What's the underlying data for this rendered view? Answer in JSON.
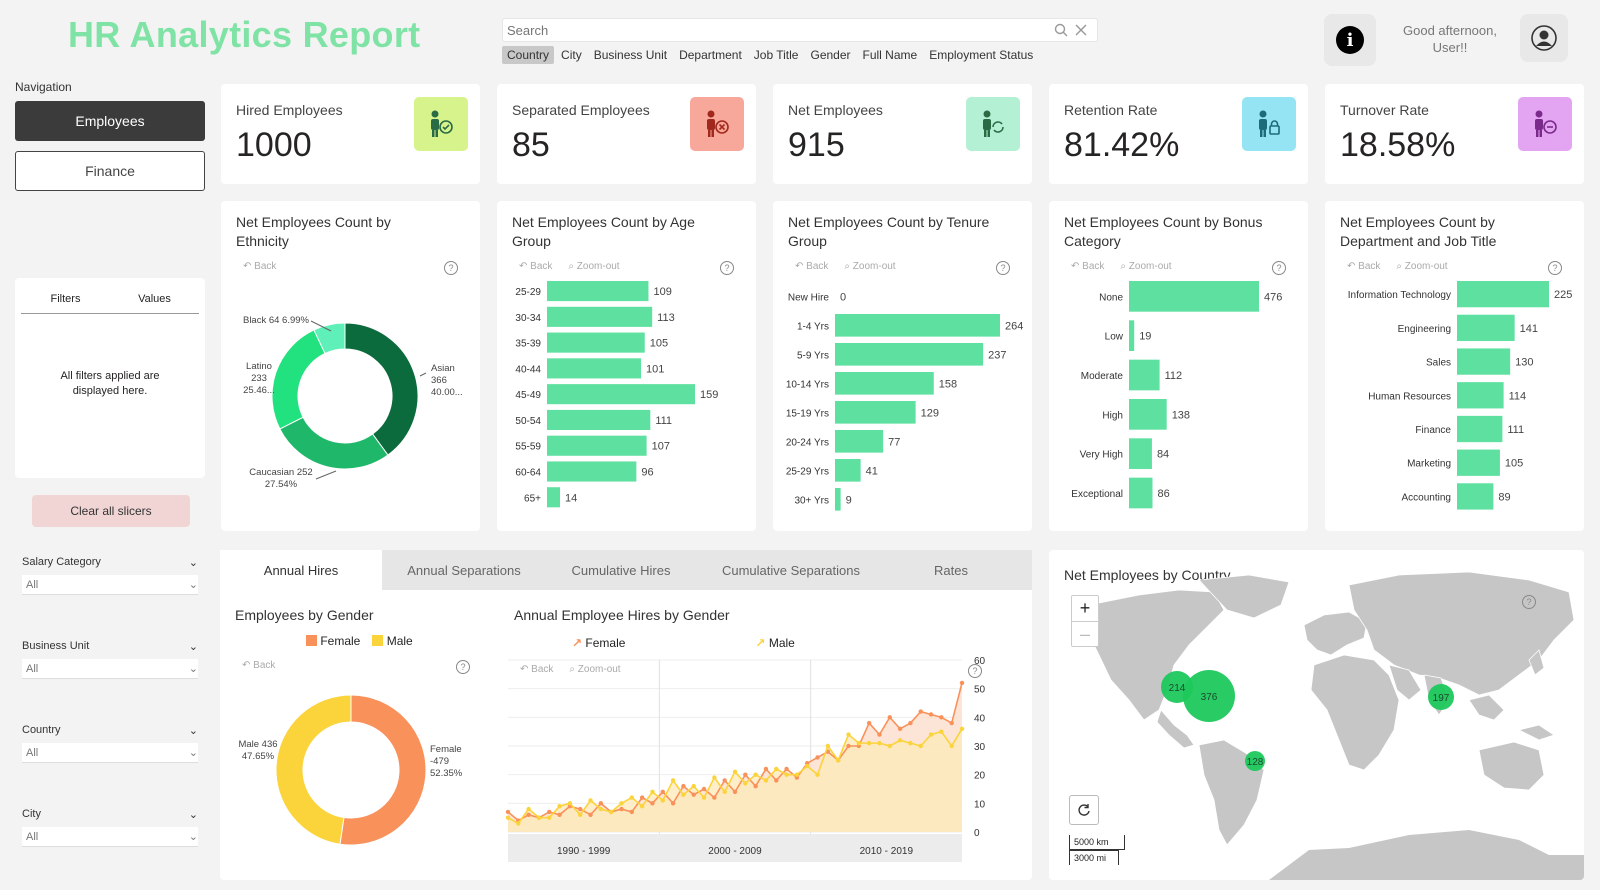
{
  "header": {
    "title": "HR Analytics Report",
    "search_placeholder": "Search",
    "search_fields": [
      "Country",
      "City",
      "Business Unit",
      "Department",
      "Job Title",
      "Gender",
      "Full Name",
      "Employment Status"
    ],
    "greeting": "Good afternoon, User!!"
  },
  "nav": {
    "label": "Navigation",
    "items": [
      "Employees",
      "Finance"
    ],
    "active": "Employees"
  },
  "filters": {
    "col1": "Filters",
    "col2": "Values",
    "message": "All filters applied are displayed here.",
    "clear_label": "Clear all slicers"
  },
  "slicers": [
    {
      "title": "Salary Category",
      "value": "All"
    },
    {
      "title": "Business Unit",
      "value": "All"
    },
    {
      "title": "Country",
      "value": "All"
    },
    {
      "title": "City",
      "value": "All"
    }
  ],
  "kpis": [
    {
      "label": "Hired Employees",
      "value": "1000",
      "icon": "hire-icon",
      "color": "#d7f38c"
    },
    {
      "label": "Separated Employees",
      "value": "85",
      "icon": "separate-icon",
      "color": "#f7a89a"
    },
    {
      "label": "Net Employees",
      "value": "915",
      "icon": "net-icon",
      "color": "#b4f1d4"
    },
    {
      "label": "Retention Rate",
      "value": "81.42%",
      "icon": "retention-icon",
      "color": "#94e4f4"
    },
    {
      "label": "Turnover Rate",
      "value": "18.58%",
      "icon": "turnover-icon",
      "color": "#e3a5f1"
    }
  ],
  "visual_tools": {
    "back": "Back",
    "zoom": "Zoom-out",
    "help": "?"
  },
  "tabs": [
    "Annual Hires",
    "Annual Separations",
    "Cumulative Hires",
    "Cumulative Separations",
    "Rates"
  ],
  "map": {
    "title": "Net Employees by Country",
    "scale_km": "5000 km",
    "scale_mi": "3000 mi",
    "bubbles": [
      {
        "value": 214
      },
      {
        "value": 376
      },
      {
        "value": 197
      },
      {
        "value": 128
      }
    ]
  },
  "colors": {
    "accent": "#5ee0a0",
    "female": "#f9915a",
    "male": "#fbd33b"
  },
  "chart_data": [
    {
      "type": "pie",
      "title": "Net Employees Count by Ethnicity",
      "categories": [
        "Asian",
        "Caucasian",
        "Latino",
        "Black"
      ],
      "values": [
        366,
        252,
        233,
        64
      ],
      "labels": [
        "Asian 366 40.00...",
        "Caucasian 252 27.54%",
        "Latino 233 25.46...",
        "Black 64 6.99%"
      ],
      "colors": [
        "#0c6b3c",
        "#1fb86b",
        "#22e27f",
        "#5ef0b8"
      ]
    },
    {
      "type": "bar",
      "title": "Net Employees Count by Age Group",
      "categories": [
        "25-29",
        "30-34",
        "35-39",
        "40-44",
        "45-49",
        "50-54",
        "55-59",
        "60-64",
        "65+"
      ],
      "values": [
        109,
        113,
        105,
        101,
        159,
        111,
        107,
        96,
        14
      ]
    },
    {
      "type": "bar",
      "title": "Net Employees Count by Tenure Group",
      "categories": [
        "New Hire",
        "1-4 Yrs",
        "5-9 Yrs",
        "10-14 Yrs",
        "15-19 Yrs",
        "20-24 Yrs",
        "25-29 Yrs",
        "30+ Yrs"
      ],
      "values": [
        0,
        264,
        237,
        158,
        129,
        77,
        41,
        9
      ]
    },
    {
      "type": "bar",
      "title": "Net Employees Count by Bonus Category",
      "categories": [
        "None",
        "Low",
        "Moderate",
        "High",
        "Very High",
        "Exceptional"
      ],
      "values": [
        476,
        19,
        112,
        138,
        84,
        86
      ]
    },
    {
      "type": "bar",
      "title": "Net Employees Count by Department and Job Title",
      "categories": [
        "Information Technology",
        "Engineering",
        "Sales",
        "Human Resources",
        "Finance",
        "Marketing",
        "Accounting"
      ],
      "values": [
        225,
        141,
        130,
        114,
        111,
        105,
        89
      ]
    },
    {
      "type": "pie",
      "title": "Employees by Gender",
      "categories": [
        "Female",
        "Male"
      ],
      "values": [
        479,
        436
      ],
      "labels": [
        "Female 479 52.35%",
        "Male 436 47.65%"
      ],
      "colors": [
        "#f9915a",
        "#fbd33b"
      ]
    },
    {
      "type": "area",
      "title": "Annual Employee Hires by Gender",
      "x_groups": [
        "1990 - 1999",
        "2000 - 2009",
        "2010 - 2019"
      ],
      "ylim": [
        0,
        60
      ],
      "yticks": [
        0,
        10,
        20,
        30,
        40,
        50,
        60
      ],
      "series": [
        {
          "name": "Female",
          "values": [
            7,
            4,
            6,
            5,
            7,
            6,
            9,
            8,
            6,
            10,
            7,
            8,
            7,
            12,
            10,
            14,
            10,
            16,
            13,
            15,
            12,
            18,
            14,
            20,
            16,
            22,
            18,
            22,
            19,
            24,
            26,
            28,
            25,
            30,
            30,
            38,
            34,
            40,
            36,
            38,
            42,
            41,
            40,
            38,
            52
          ]
        },
        {
          "name": "Male",
          "values": [
            5,
            3,
            8,
            5,
            5,
            9,
            10,
            6,
            11,
            8,
            7,
            10,
            12,
            9,
            14,
            11,
            18,
            13,
            16,
            12,
            19,
            14,
            21,
            17,
            20,
            18,
            22,
            20,
            20,
            23,
            20,
            30,
            25,
            34,
            31,
            31,
            31,
            30,
            32,
            31,
            30,
            34,
            35,
            30,
            36
          ]
        }
      ]
    }
  ]
}
